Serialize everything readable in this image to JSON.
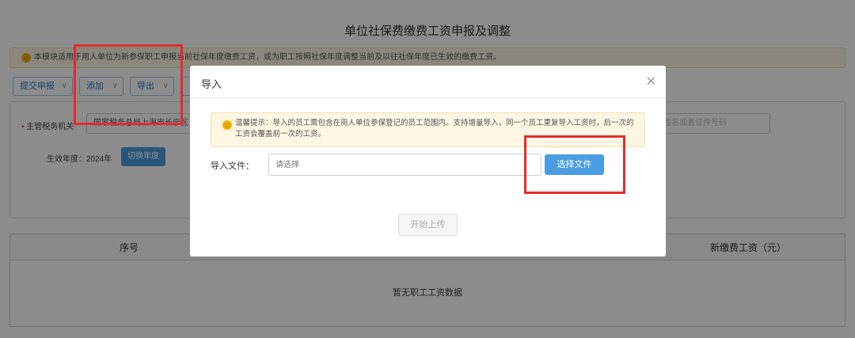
{
  "page_title": "单位社保费缴费工资申报及调整",
  "notice": "本模块适用于用人单位为新参保职工申报当前社保年度缴费工资，或为职工按照社保年度调整当前及以往社保年度已生效的缴费工资。",
  "toolbar": {
    "submit": "提交申报",
    "add": "添加",
    "export": "导出"
  },
  "form": {
    "tax_authority_label": "主管税务机关",
    "tax_authority_value": "国家税务总局上海市长宁区",
    "id_placeholder": "姓名或者证件号码",
    "effective_year_label": "生效年度：2024年",
    "switch_year": "切换年度"
  },
  "table": {
    "col_index": "序号",
    "col_new_wage": "新缴费工资（元）",
    "empty": "暂无职工工资数据"
  },
  "dialog": {
    "title": "导入",
    "tip": "温馨提示：导入的员工需包含在用人单位参保登记的员工范围内。支持增量导入，同一个员工重复导入工资时，后一次的工资会覆盖前一次的工资。",
    "file_label": "导入文件：",
    "file_placeholder": "请选择",
    "choose_file": "选择文件",
    "start_upload": "开始上传"
  },
  "colors": {
    "accent": "#4a9de0",
    "highlight": "#e52b2b",
    "notice_bg": "#fdf6e3"
  }
}
